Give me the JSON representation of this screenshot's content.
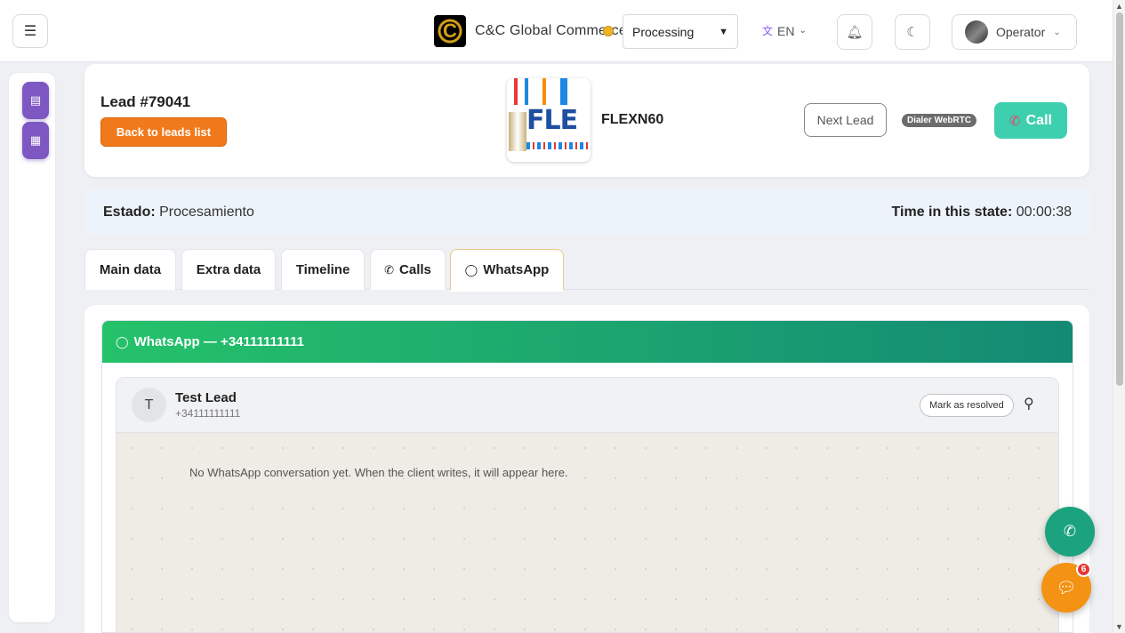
{
  "topbar": {
    "menu_icon": "hamburger-icon",
    "brand_name": "C&C Global Commerce FZ LLC",
    "brand_logo_letter": "C",
    "status_value": "Processing",
    "status_color": "#f0b323",
    "language": "EN",
    "user_name": "Operator"
  },
  "sidebar": {
    "items": [
      {
        "icon": "list-icon",
        "glyph": "▤"
      },
      {
        "icon": "cart-icon",
        "glyph": "▦"
      }
    ],
    "accent_color": "#7e57c2"
  },
  "lead": {
    "id_label": "Lead #79041",
    "back_label": "Back to leads list",
    "product_name": "FLEXN60",
    "product_logo_text": "FLE",
    "next_label": "Next Lead",
    "dialer_badge": "Dialer WebRTC",
    "call_label": "Call",
    "call_color": "#3ecfae"
  },
  "state": {
    "estado_label": "Estado:",
    "estado_value": "Procesamiento",
    "time_label": "Time in this state:",
    "time_value": "00:00:38"
  },
  "tabs": [
    {
      "label": "Main data",
      "active": false
    },
    {
      "label": "Extra data",
      "active": false
    },
    {
      "label": "Timeline",
      "active": false
    },
    {
      "label": "Calls",
      "icon": "phone-icon",
      "active": false
    },
    {
      "label": "WhatsApp",
      "icon": "whatsapp-icon",
      "active": true
    }
  ],
  "whatsapp": {
    "header": "WhatsApp — +34111111111",
    "contact_initial": "T",
    "contact_name": "Test Lead",
    "contact_phone": "+34111111111",
    "resolve_label": "Mark as resolved",
    "empty_message": "No WhatsApp conversation yet. When the client writes, it will appear here.",
    "gradient_start": "#25c26a",
    "gradient_end": "#138a74"
  },
  "floating": {
    "chat_badge": "6"
  }
}
